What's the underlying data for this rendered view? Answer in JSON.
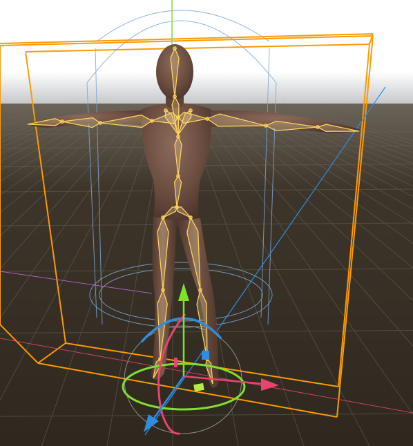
{
  "viewport": {
    "background_top": "#8e949b",
    "horizon": "#b4b8bc",
    "floor": "#3a3227",
    "grid_color": "#5a534a"
  },
  "colors": {
    "bounds_box": "#ff9a00",
    "bone_outline": "#ffd35a",
    "bone_fill": "#ffe9a6",
    "collider": "#7aa7d6",
    "axis_x": "#e8446e",
    "axis_y": "#7fe02f",
    "axis_z": "#2f8de0",
    "figure": "#6b4d40"
  },
  "gizmo": {
    "mode": "transform"
  }
}
